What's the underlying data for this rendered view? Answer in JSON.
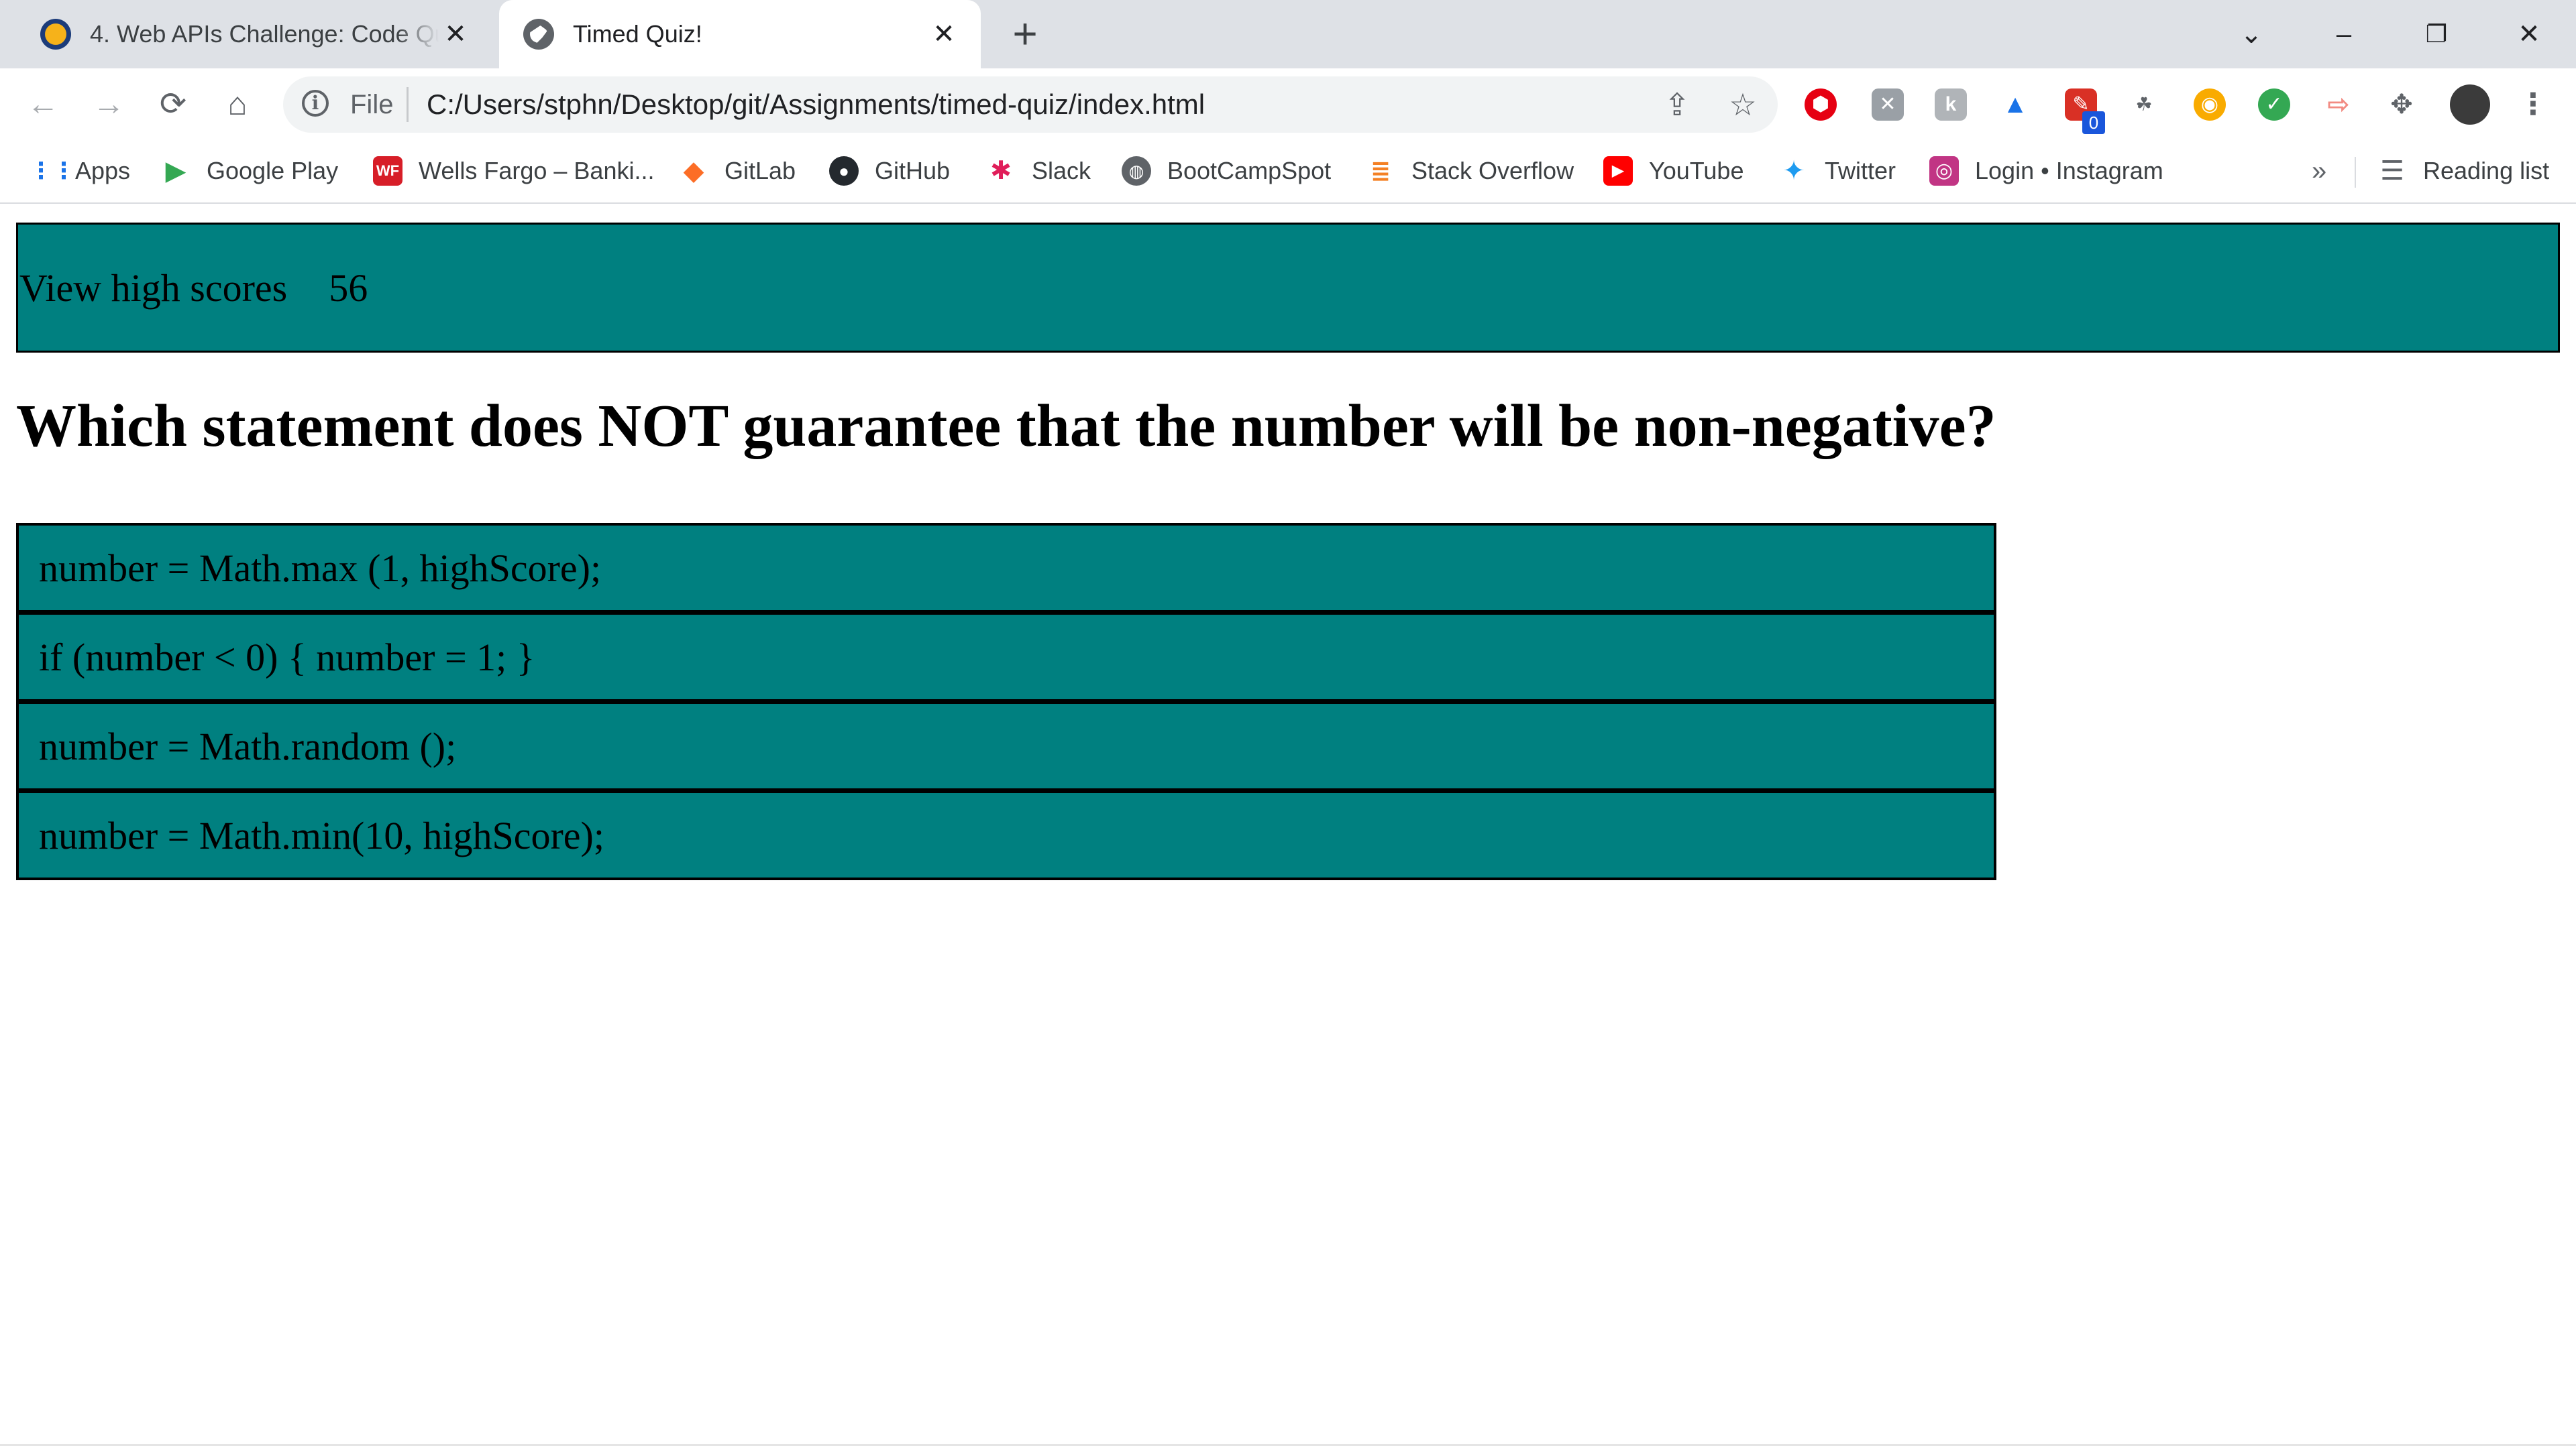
{
  "tabs": [
    {
      "title": "4. Web APIs Challenge: Code Quiz",
      "active": false,
      "favicon": "codingbootcamp-icon"
    },
    {
      "title": "Timed Quiz!",
      "active": true,
      "favicon": "globe-icon"
    }
  ],
  "window_controls": {
    "tab_search": "⌄",
    "minimize": "–",
    "restore": "❐",
    "close": "✕"
  },
  "toolbar": {
    "file_label": "File",
    "url": "C:/Users/stphn/Desktop/git/Assignments/timed-quiz/index.html",
    "extension_badge": "0"
  },
  "bookmarks": [
    {
      "label": "Apps",
      "icon": "apps-grid-icon"
    },
    {
      "label": "Google Play",
      "icon": "google-play-icon"
    },
    {
      "label": "Wells Fargo – Banki...",
      "icon": "wells-fargo-icon"
    },
    {
      "label": "GitLab",
      "icon": "gitlab-icon"
    },
    {
      "label": "GitHub",
      "icon": "github-icon"
    },
    {
      "label": "Slack",
      "icon": "slack-icon"
    },
    {
      "label": "BootCampSpot",
      "icon": "globe-icon"
    },
    {
      "label": "Stack Overflow",
      "icon": "stack-overflow-icon"
    },
    {
      "label": "YouTube",
      "icon": "youtube-icon"
    },
    {
      "label": "Twitter",
      "icon": "twitter-icon"
    },
    {
      "label": "Login • Instagram",
      "icon": "instagram-icon"
    }
  ],
  "bookmarks_overflow": "»",
  "reading_list": "Reading list",
  "quiz": {
    "high_scores_link": "View high scores",
    "timer": "56",
    "question": "Which statement does NOT guarantee that the number will be non-negative?",
    "answers": [
      "number = Math.max (1, highScore);",
      "if (number < 0) { number = 1; }",
      "number = Math.random ();",
      "number = Math.min(10, highScore);"
    ]
  },
  "colors": {
    "accent": "#008080",
    "tabstrip": "#dee1e6"
  }
}
